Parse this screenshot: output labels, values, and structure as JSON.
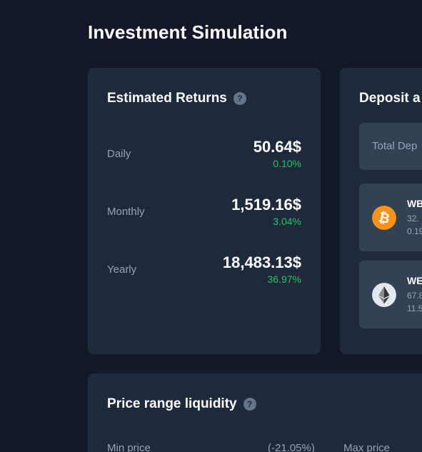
{
  "page": {
    "title": "Investment Simulation"
  },
  "returns": {
    "title": "Estimated Returns",
    "help": "?",
    "rows": [
      {
        "label": "Daily",
        "amount": "50.64$",
        "percent": "0.10%"
      },
      {
        "label": "Monthly",
        "amount": "1,519.16$",
        "percent": "3.04%"
      },
      {
        "label": "Yearly",
        "amount": "18,483.13$",
        "percent": "36.97%"
      }
    ]
  },
  "deposit": {
    "title": "Deposit a",
    "total_label": "Total Dep",
    "assets": [
      {
        "icon": "bitcoin-icon",
        "name": "WB",
        "line1": "32.",
        "line2": "0.19"
      },
      {
        "icon": "ethereum-icon",
        "name": "WE",
        "line1": "67.8",
        "line2": "11.5"
      }
    ]
  },
  "price_range": {
    "title": "Price range liquidity",
    "help": "?",
    "min_label": "Min price",
    "min_change": "(-21.05%)",
    "max_label": "Max price"
  },
  "colors": {
    "background": "#111827",
    "card": "#1e293b",
    "inner_card": "#334155",
    "positive": "#22c55e",
    "bitcoin": "#f7931a",
    "ethereum_bg": "#e2e8f0"
  }
}
